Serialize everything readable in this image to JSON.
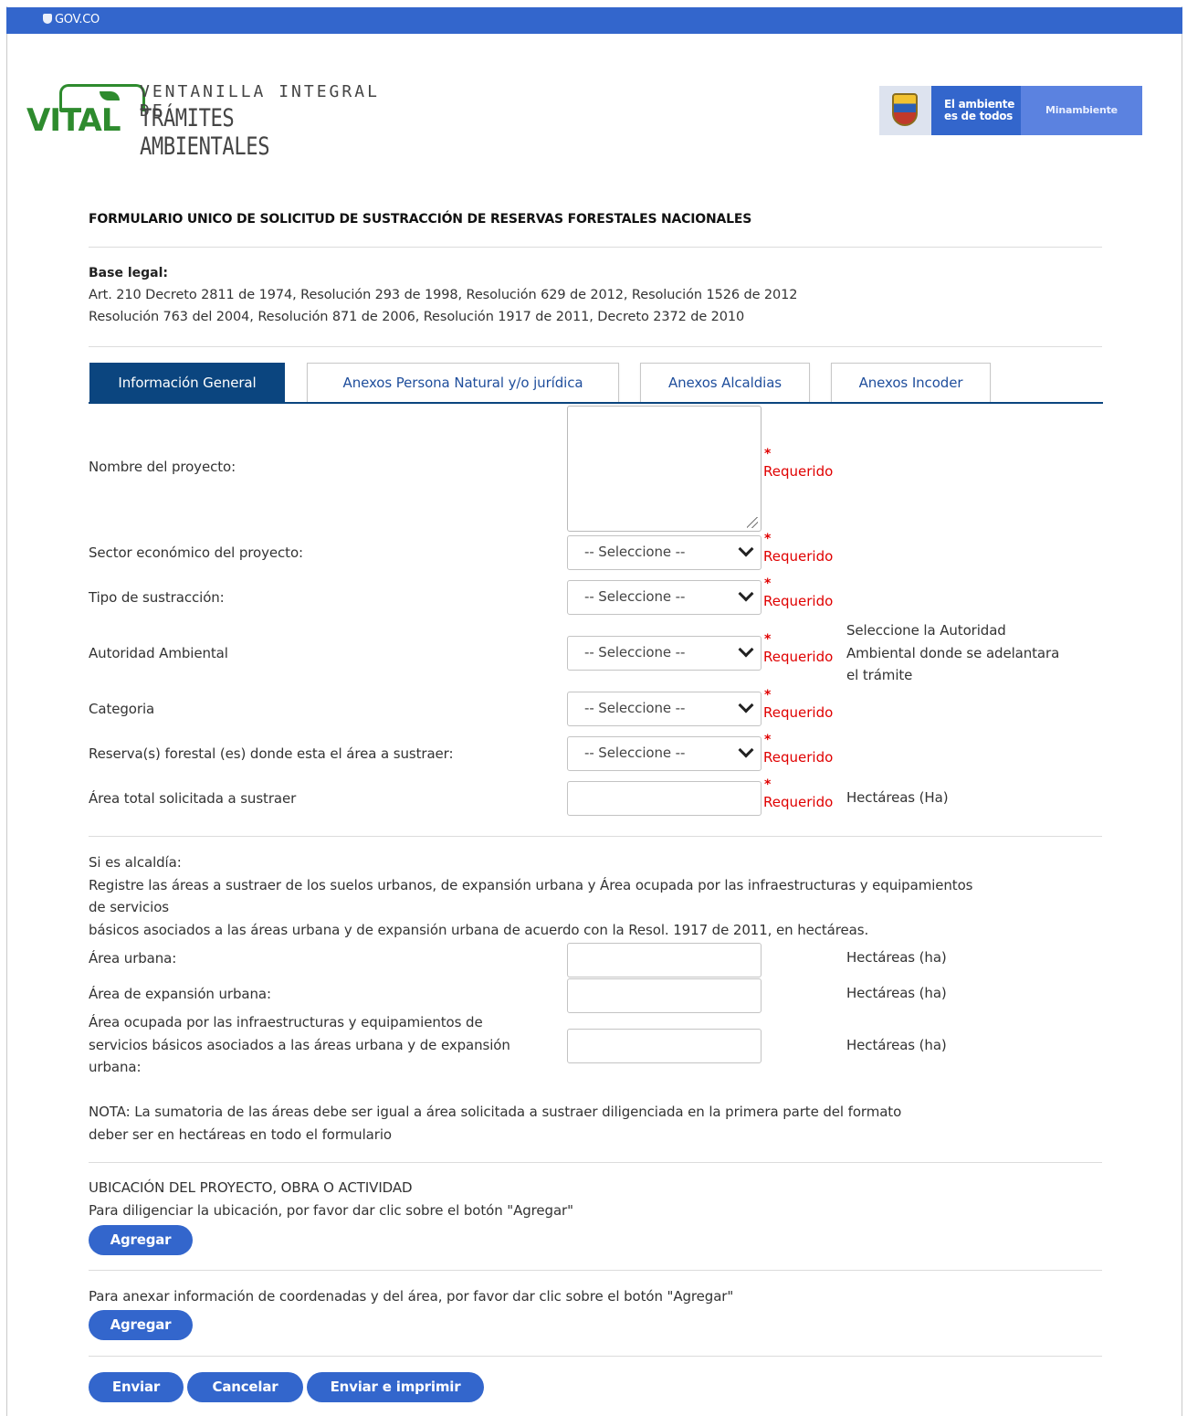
{
  "topbar": {
    "gov_label": "GOV.CO"
  },
  "header": {
    "logo_word": "VITAL",
    "logo_line1": "VENTANILLA INTEGRAL DE",
    "logo_line2": "TRÁMITES AMBIENTALES",
    "gov_slogan_1": "El ambiente",
    "gov_slogan_2": "es de todos",
    "ministry": "Minambiente"
  },
  "form": {
    "title": "FORMULARIO UNICO DE SOLICITUD DE SUSTRACCIÓN DE RESERVAS FORESTALES NACIONALES",
    "base_title": "Base legal:",
    "base_lines": [
      "Art. 210 Decreto 2811 de 1974, Resolución 293 de 1998, Resolución 629 de 2012, Resolución 1526 de 2012",
      "Resolución 763 del 2004, Resolución 871 de 2006, Resolución 1917 de 2011, Decreto 2372 de 2010"
    ]
  },
  "tabs": [
    {
      "label": "Información General",
      "active": true
    },
    {
      "label": "Anexos Persona Natural y/o jurídica",
      "active": false
    },
    {
      "label": "Anexos Alcaldias",
      "active": false
    },
    {
      "label": "Anexos Incoder",
      "active": false
    }
  ],
  "fields": {
    "required_mark": "*",
    "required_text": "Requerido",
    "select_placeholder": "-- Seleccione --",
    "nombre_label": "Nombre del proyecto:",
    "sector_label": "Sector económico del proyecto:",
    "tipo_label": "Tipo de sustracción:",
    "autoridad_label": "Autoridad Ambiental",
    "autoridad_help": [
      "Seleccione la Autoridad",
      "Ambiental donde se adelantara",
      "el trámite"
    ],
    "categoria_label": "Categoria",
    "reserva_label": "Reserva(s) forestal (es) donde esta el área a sustraer:",
    "area_total_label": "Área total solicitada a sustraer",
    "area_total_unit": "Hectáreas (Ha)"
  },
  "alcaldia": {
    "intro": "Si es alcaldía:",
    "desc_1": "Registre las áreas a sustraer de los suelos urbanos, de expansión urbana y Área ocupada por las infraestructuras y equipamientos",
    "desc_2": "de servicios",
    "desc_3": "básicos asociados a las áreas urbana y de expansión urbana de acuerdo con la Resol. 1917 de 2011, en hectáreas.",
    "urbana_label": "Área urbana:",
    "expansion_label": "Área de expansión urbana:",
    "infra_label_1": "Área ocupada por las infraestructuras y equipamientos de",
    "infra_label_2": "servicios básicos asociados a las áreas urbana y de expansión",
    "infra_label_3": "urbana:",
    "unit": "Hectáreas (ha)",
    "nota_1": "NOTA: La sumatoria de las áreas debe ser igual a área solicitada a sustraer diligenciada en la primera parte del formato",
    "nota_2": "deber ser en hectáreas en todo el formulario"
  },
  "ubicacion": {
    "title": "UBICACIÓN DEL PROYECTO, OBRA O ACTIVIDAD",
    "hint": "Para diligenciar la ubicación, por favor dar clic sobre el botón \"Agregar\"",
    "add_label": "Agregar"
  },
  "coordenadas": {
    "hint": "Para anexar información de coordenadas y del área, por favor dar clic sobre el botón \"Agregar\"",
    "add_label": "Agregar"
  },
  "actions": {
    "send": "Enviar",
    "cancel": "Cancelar",
    "send_print": "Enviar e imprimir"
  }
}
